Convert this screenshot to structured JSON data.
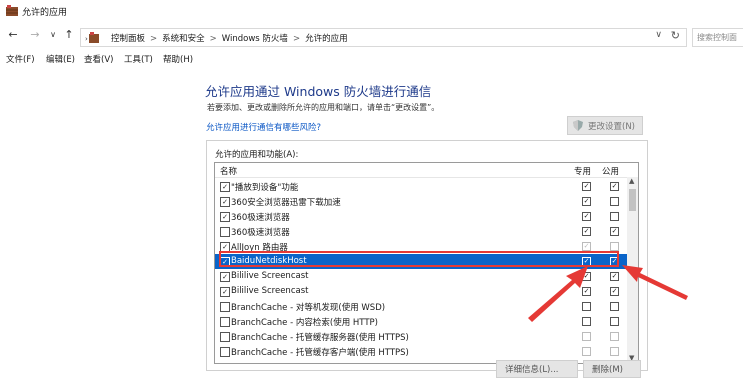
{
  "window": {
    "title": "允许的应用"
  },
  "nav": {
    "back": "←",
    "forward": "→",
    "recent": "∨",
    "up": "↑"
  },
  "address": {
    "crumbs": [
      "控制面板",
      "系统和安全",
      "Windows 防火墙",
      "允许的应用"
    ],
    "separator": ">",
    "dropdown": "∨",
    "refresh": "↻"
  },
  "search": {
    "placeholder": "搜索控制面"
  },
  "menu": [
    "文件(F)",
    "编辑(E)",
    "查看(V)",
    "工具(T)",
    "帮助(H)"
  ],
  "main": {
    "heading": "允许应用通过 Windows 防火墙进行通信",
    "subtext": "若要添加、更改或删除所允许的应用和端口，请单击“更改设置”。",
    "risk_link": "允许应用进行通信有哪些风险?",
    "change_settings": "更改设置(N)",
    "group_label": "允许的应用和功能(A):",
    "columns": {
      "name": "名称",
      "private": "专用",
      "public": "公用"
    },
    "rows": [
      {
        "name": "\"播放到设备\"功能",
        "checked": true,
        "private": true,
        "public": true,
        "grey": false
      },
      {
        "name": "360安全浏览器迅雷下载加速",
        "checked": true,
        "private": true,
        "public": false,
        "grey": false
      },
      {
        "name": "360极速浏览器",
        "checked": true,
        "private": true,
        "public": false,
        "grey": false
      },
      {
        "name": "360极速浏览器",
        "checked": false,
        "private": true,
        "public": true,
        "grey": false
      },
      {
        "name": "AllJoyn 路由器",
        "checked": true,
        "private": true,
        "public": false,
        "grey": true
      },
      {
        "name": "BaiduNetdiskHost",
        "checked": true,
        "private": true,
        "public": true,
        "grey": false,
        "selected": true
      },
      {
        "name": "Bililive Screencast",
        "checked": true,
        "private": true,
        "public": true,
        "grey": false
      },
      {
        "name": "Bililive Screencast",
        "checked": true,
        "private": true,
        "public": true,
        "grey": false
      },
      {
        "name": "BranchCache - 对等机发现(使用 WSD)",
        "checked": false,
        "private": false,
        "public": false,
        "grey": false
      },
      {
        "name": "BranchCache - 内容检索(使用 HTTP)",
        "checked": false,
        "private": false,
        "public": false,
        "grey": false
      },
      {
        "name": "BranchCache - 托管缓存服务器(使用 HTTPS)",
        "checked": false,
        "private": false,
        "public": false,
        "grey": true
      },
      {
        "name": "BranchCache - 托管缓存客户端(使用 HTTPS)",
        "checked": false,
        "private": false,
        "public": false,
        "grey": true
      }
    ],
    "details_button": "详细信息(L)...",
    "delete_button": "删除(M)"
  },
  "colors": {
    "accent": "#0a64c9",
    "highlight": "#e53935",
    "heading": "#1e3a8a",
    "link": "#0b57c5"
  },
  "icons": [
    "firewall-icon",
    "folder-icon",
    "shield-icon",
    "scroll-up-icon",
    "scroll-down-icon"
  ]
}
